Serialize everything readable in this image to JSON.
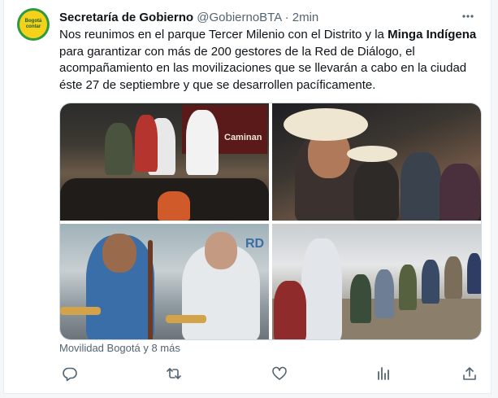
{
  "author": {
    "name": "Secretaría de Gobierno",
    "handle": "@GobiernoBTA",
    "separator": "·",
    "time": "2min",
    "avatar_text_top": "Bogotá",
    "avatar_text_bottom": "contar"
  },
  "tweet": {
    "text_1": "Nos reunimos en el parque Tercer Milenio con el Distrito y la ",
    "text_bold": "Minga Indígena",
    "text_2": " para garantizar con más de 200 gestores de la Red de Diálogo, el acompañamiento en las movilizaciones que se llevarán a cabo en la ciudad éste 27 de septiembre y que se desarrollen pacíficamente."
  },
  "media": {
    "photo_1_sign": "Caminan",
    "photo_3_sign": "RD",
    "credit": "Movilidad Bogotá y 8 más"
  },
  "colors": {
    "text": "#0f1419",
    "muted": "#536471",
    "border": "#cfd9de"
  },
  "icons": [
    "more-icon",
    "reply-icon",
    "retweet-icon",
    "like-icon",
    "views-icon",
    "share-icon"
  ]
}
